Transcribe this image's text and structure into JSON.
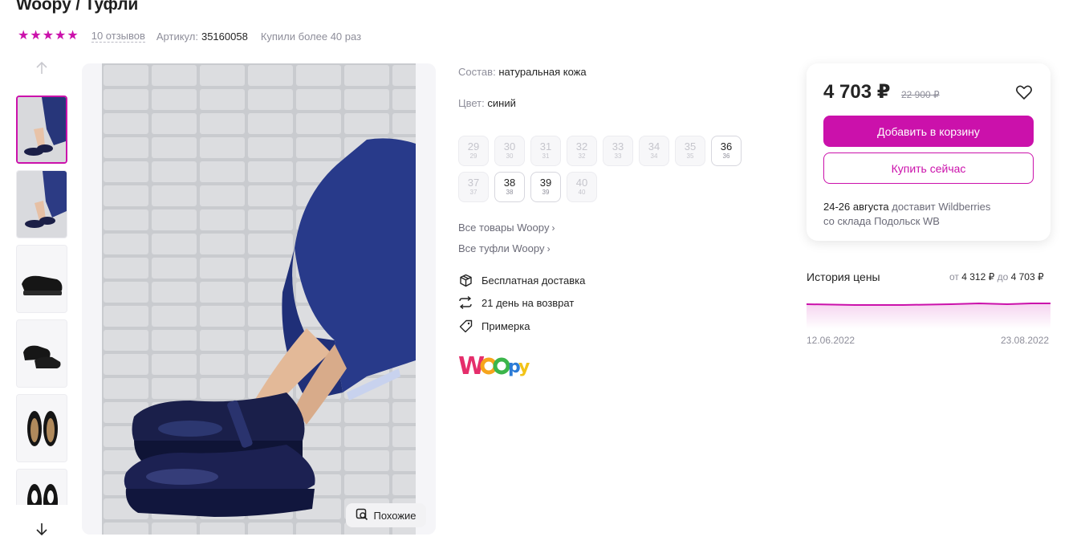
{
  "product": {
    "title": "Woopy / Туфли",
    "rating_stars": 5,
    "reviews": "10 отзывов",
    "sku_label": "Артикул:",
    "sku_value": "35160058",
    "bought": "Купили более 40 раз"
  },
  "gallery": {
    "up_icon": "arrow-up-icon",
    "down_icon": "arrow-down-icon",
    "similar_label": "Похожие",
    "similar_icon": "search-image-icon"
  },
  "details": {
    "composition_label": "Состав:",
    "composition_value": "натуральная кожа",
    "color_label": "Цвет:",
    "color_value": "синий",
    "sizes": [
      {
        "ru": "29",
        "eu": "29",
        "available": false
      },
      {
        "ru": "30",
        "eu": "30",
        "available": false
      },
      {
        "ru": "31",
        "eu": "31",
        "available": false
      },
      {
        "ru": "32",
        "eu": "32",
        "available": false
      },
      {
        "ru": "33",
        "eu": "33",
        "available": false
      },
      {
        "ru": "34",
        "eu": "34",
        "available": false
      },
      {
        "ru": "35",
        "eu": "35",
        "available": false
      },
      {
        "ru": "36",
        "eu": "36",
        "available": true
      },
      {
        "ru": "37",
        "eu": "37",
        "available": false
      },
      {
        "ru": "38",
        "eu": "38",
        "available": true
      },
      {
        "ru": "39",
        "eu": "39",
        "available": true
      },
      {
        "ru": "40",
        "eu": "40",
        "available": false
      }
    ],
    "link_all": "Все товары Woopy",
    "link_shoes": "Все туфли Woopy",
    "features": [
      {
        "label": "Бесплатная доставка",
        "icon": "box-icon"
      },
      {
        "label": "21 день на возврат",
        "icon": "return-arrows-icon"
      },
      {
        "label": "Примерка",
        "icon": "tag-icon"
      }
    ],
    "brand_logo_text": "Woopy"
  },
  "buy": {
    "price": "4 703 ₽",
    "old_price": "22 900 ₽",
    "add_to_cart": "Добавить в корзину",
    "buy_now": "Купить сейчас",
    "delivery_dates": "24-26 августа",
    "delivery_rest": " доставит Wildberries",
    "delivery_warehouse": "со склада Подольск WB"
  },
  "history": {
    "title": "История цены",
    "from_label": "от",
    "min_price": "4 312 ₽",
    "to_label": "до",
    "max_price": "4 703 ₽",
    "start_date": "12.06.2022",
    "end_date": "23.08.2022"
  },
  "colors": {
    "accent": "#cb11ab",
    "text": "#242424",
    "muted": "#8e8e9a"
  }
}
